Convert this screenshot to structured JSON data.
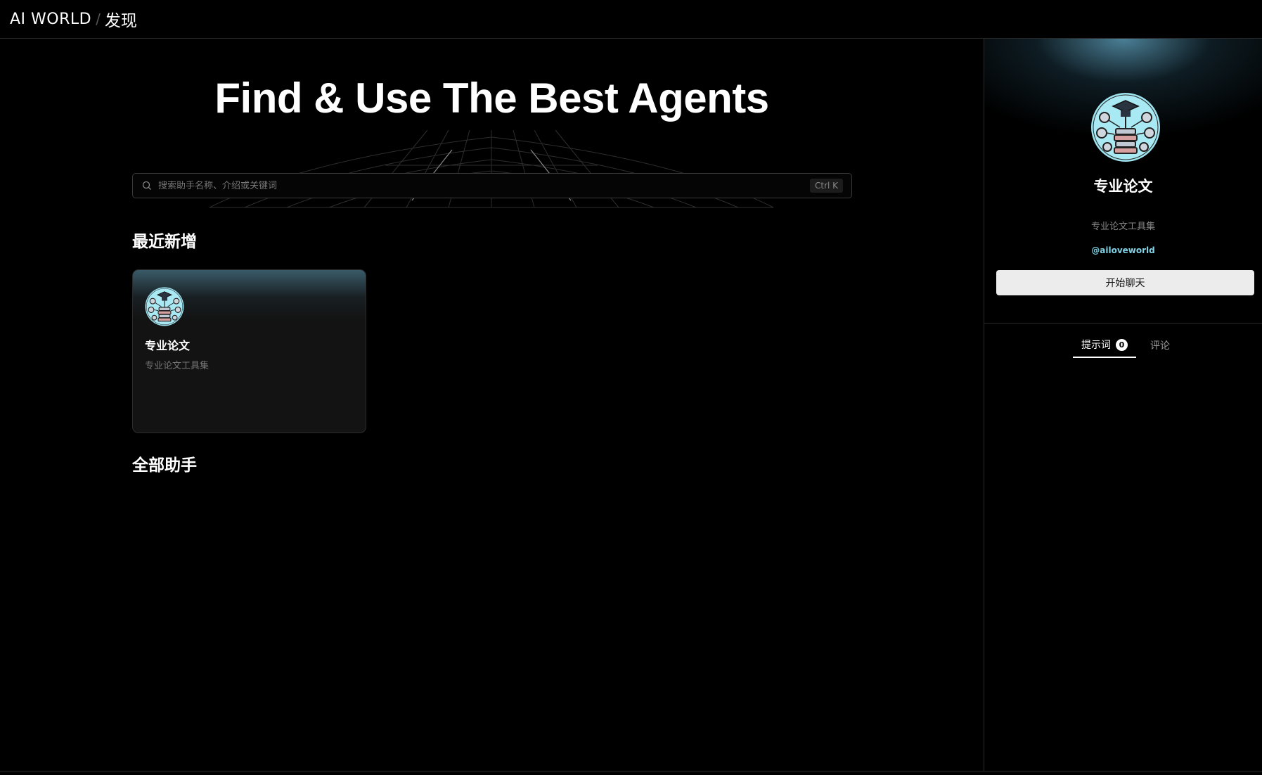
{
  "header": {
    "brand": "AI WORLD",
    "separator": "/",
    "crumb": "发现"
  },
  "hero": {
    "title": "Find & Use The Best Agents"
  },
  "search": {
    "placeholder": "搜索助手名称、介绍或关键词",
    "shortcut": "Ctrl K"
  },
  "sections": {
    "recent": "最近新增",
    "all": "全部助手"
  },
  "recent_cards": [
    {
      "title": "专业论文",
      "description": "专业论文工具集",
      "icon": "academic-books-avatar-icon"
    }
  ],
  "detail_panel": {
    "title": "专业论文",
    "description": "专业论文工具集",
    "author": "@ailoveworld",
    "start_button": "开始聊天",
    "tabs": [
      {
        "label": "提示词",
        "count": "0",
        "active": true
      },
      {
        "label": "评论",
        "active": false
      }
    ],
    "accent_color": "#7fd3e6"
  }
}
